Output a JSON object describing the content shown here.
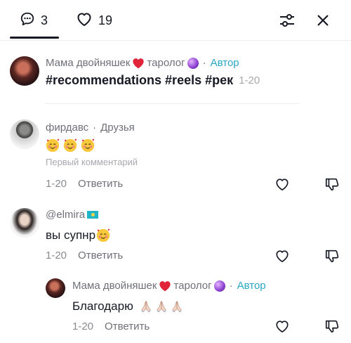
{
  "tabs": {
    "comments_count": "3",
    "likes_count": "19"
  },
  "post": {
    "username": "Мама двойняшек",
    "author_badge": "Автор",
    "text": "#recommendations #reels #рек",
    "time": "1-20"
  },
  "comments": [
    {
      "username": "фирдавс",
      "badge": "Друзья",
      "first_comment_label": "Первый комментарий",
      "time": "1-20",
      "reply_label": "Ответить"
    },
    {
      "username": "@elmira",
      "text": "вы супнр",
      "time": "1-20",
      "reply_label": "Ответить"
    },
    {
      "username": "Мама двойняшек",
      "part2": "таролог",
      "author_badge": "Автор",
      "text": "Благодарю",
      "time": "1-20",
      "reply_label": "Ответить"
    }
  ],
  "post_username_part2": "таролог",
  "colors": {
    "accent_author": "#2aa6c4",
    "text_primary": "#161823",
    "text_secondary": "#6f7078",
    "text_muted": "#a7a8ad"
  },
  "icons": [
    "comment-icon",
    "heart-outline-icon",
    "filter-icon",
    "close-icon",
    "like-icon",
    "dislike-icon",
    "red-heart-emoji",
    "crystal-ball-emoji",
    "smiling-face-with-hearts-emoji",
    "kazakhstan-flag-emoji",
    "folded-hands-emoji"
  ]
}
